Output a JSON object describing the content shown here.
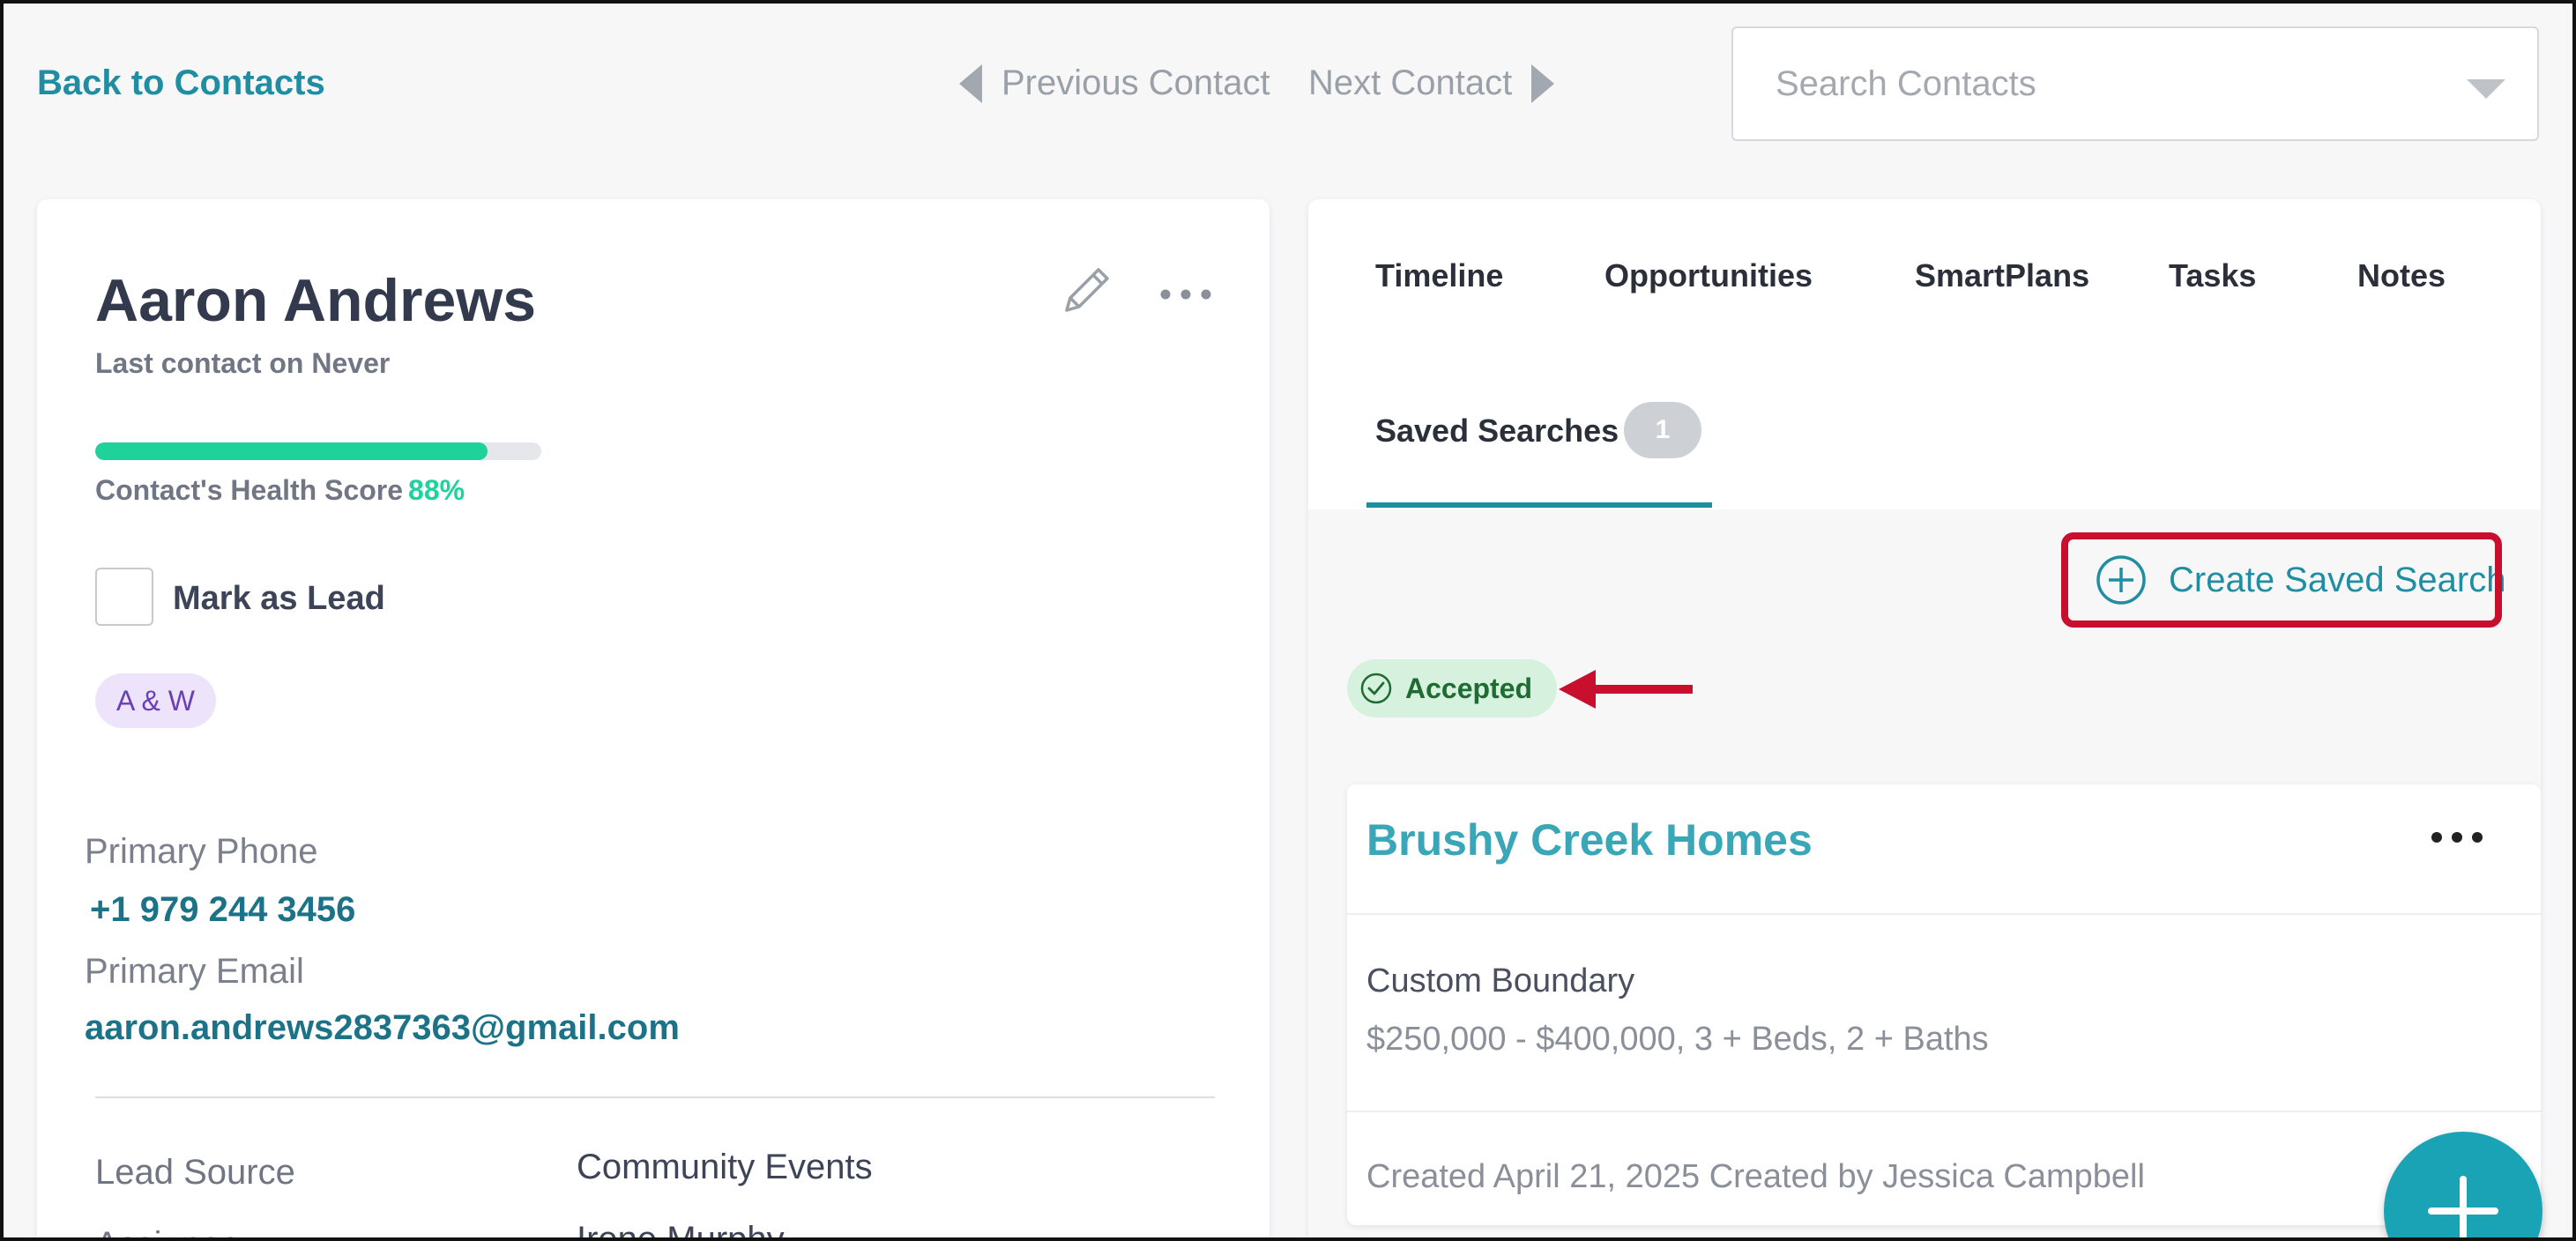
{
  "topbar": {
    "back_label": "Back to Contacts",
    "prev_label": "Previous Contact",
    "next_label": "Next Contact",
    "search_placeholder": "Search Contacts",
    "search_value": ""
  },
  "contact": {
    "name": "Aaron Andrews",
    "last_contact": "Last contact on Never",
    "health_label": "Contact's Health Score",
    "health_percent_text": "88%",
    "health_percent": 88,
    "mark_as_lead_label": "Mark as Lead",
    "mark_as_lead_checked": false,
    "tag": "A & W",
    "phone_label": "Primary Phone",
    "phone_value": "+1 979 244 3456",
    "email_label": "Primary Email",
    "email_value": "aaron.andrews2837363@gmail.com",
    "lead_source_label": "Lead Source",
    "lead_source_value": "Community Events",
    "assignee_label": "Assignee",
    "assignee_value": "Irene Murphy"
  },
  "tabs": {
    "timeline": "Timeline",
    "opportunities": "Opportunities",
    "smartplans": "SmartPlans",
    "tasks": "Tasks",
    "notes": "Notes",
    "saved_searches": "Saved Searches",
    "saved_searches_count": "1"
  },
  "saved_searches": {
    "create_label": "Create Saved Search",
    "status_label": "Accepted",
    "item": {
      "title": "Brushy Creek Homes",
      "boundary": "Custom Boundary",
      "criteria": "$250,000 - $400,000, 3 + Beds, 2 + Baths",
      "created": "Created April 21, 2025 Created by Jessica Campbell"
    }
  },
  "colors": {
    "accent": "#1f8ea2",
    "health_green": "#1fd29a",
    "highlight_red": "#c8102e",
    "tag_purple": "#6a3fb6"
  },
  "icons": {
    "prev": "triangle-left-icon",
    "next": "triangle-right-icon",
    "dropdown": "chevron-down-icon",
    "edit": "pencil-icon",
    "more": "more-horizontal-icon",
    "create": "plus-circle-icon",
    "accepted": "check-circle-icon",
    "fab": "plus-icon"
  }
}
